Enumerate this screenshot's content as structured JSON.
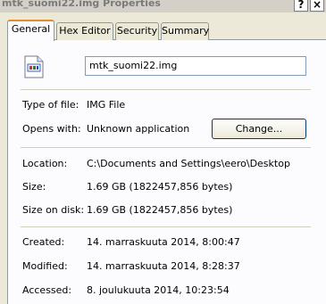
{
  "window": {
    "title": "mtk_suomi22.img Properties",
    "help_glyph": "?",
    "close_glyph": "×"
  },
  "tabs": [
    {
      "label": "General"
    },
    {
      "label": "Hex Editor"
    },
    {
      "label": "Security"
    },
    {
      "label": "Summary"
    }
  ],
  "file": {
    "icon": "generic-file-icon",
    "name": "mtk_suomi22.img"
  },
  "props": {
    "type_label": "Type of file:",
    "type_value": "IMG File",
    "opens_label": "Opens with:",
    "opens_value": "Unknown application",
    "change_label": "Change...",
    "location_label": "Location:",
    "location_value": "C:\\Documents and Settings\\eero\\Desktop",
    "size_label": "Size:",
    "size_value": "1.69 GB (1822457,856 bytes)",
    "size_disk_label": "Size on disk:",
    "size_disk_value": "1.69 GB (1822457,856 bytes)",
    "created_label": "Created:",
    "created_value": "14. marraskuuta 2014, 8:00:47",
    "modified_label": "Modified:",
    "modified_value": "14. marraskuuta 2014, 8:28:37",
    "accessed_label": "Accessed:",
    "accessed_value": "8. joulukuuta 2014, 10:23:54"
  }
}
